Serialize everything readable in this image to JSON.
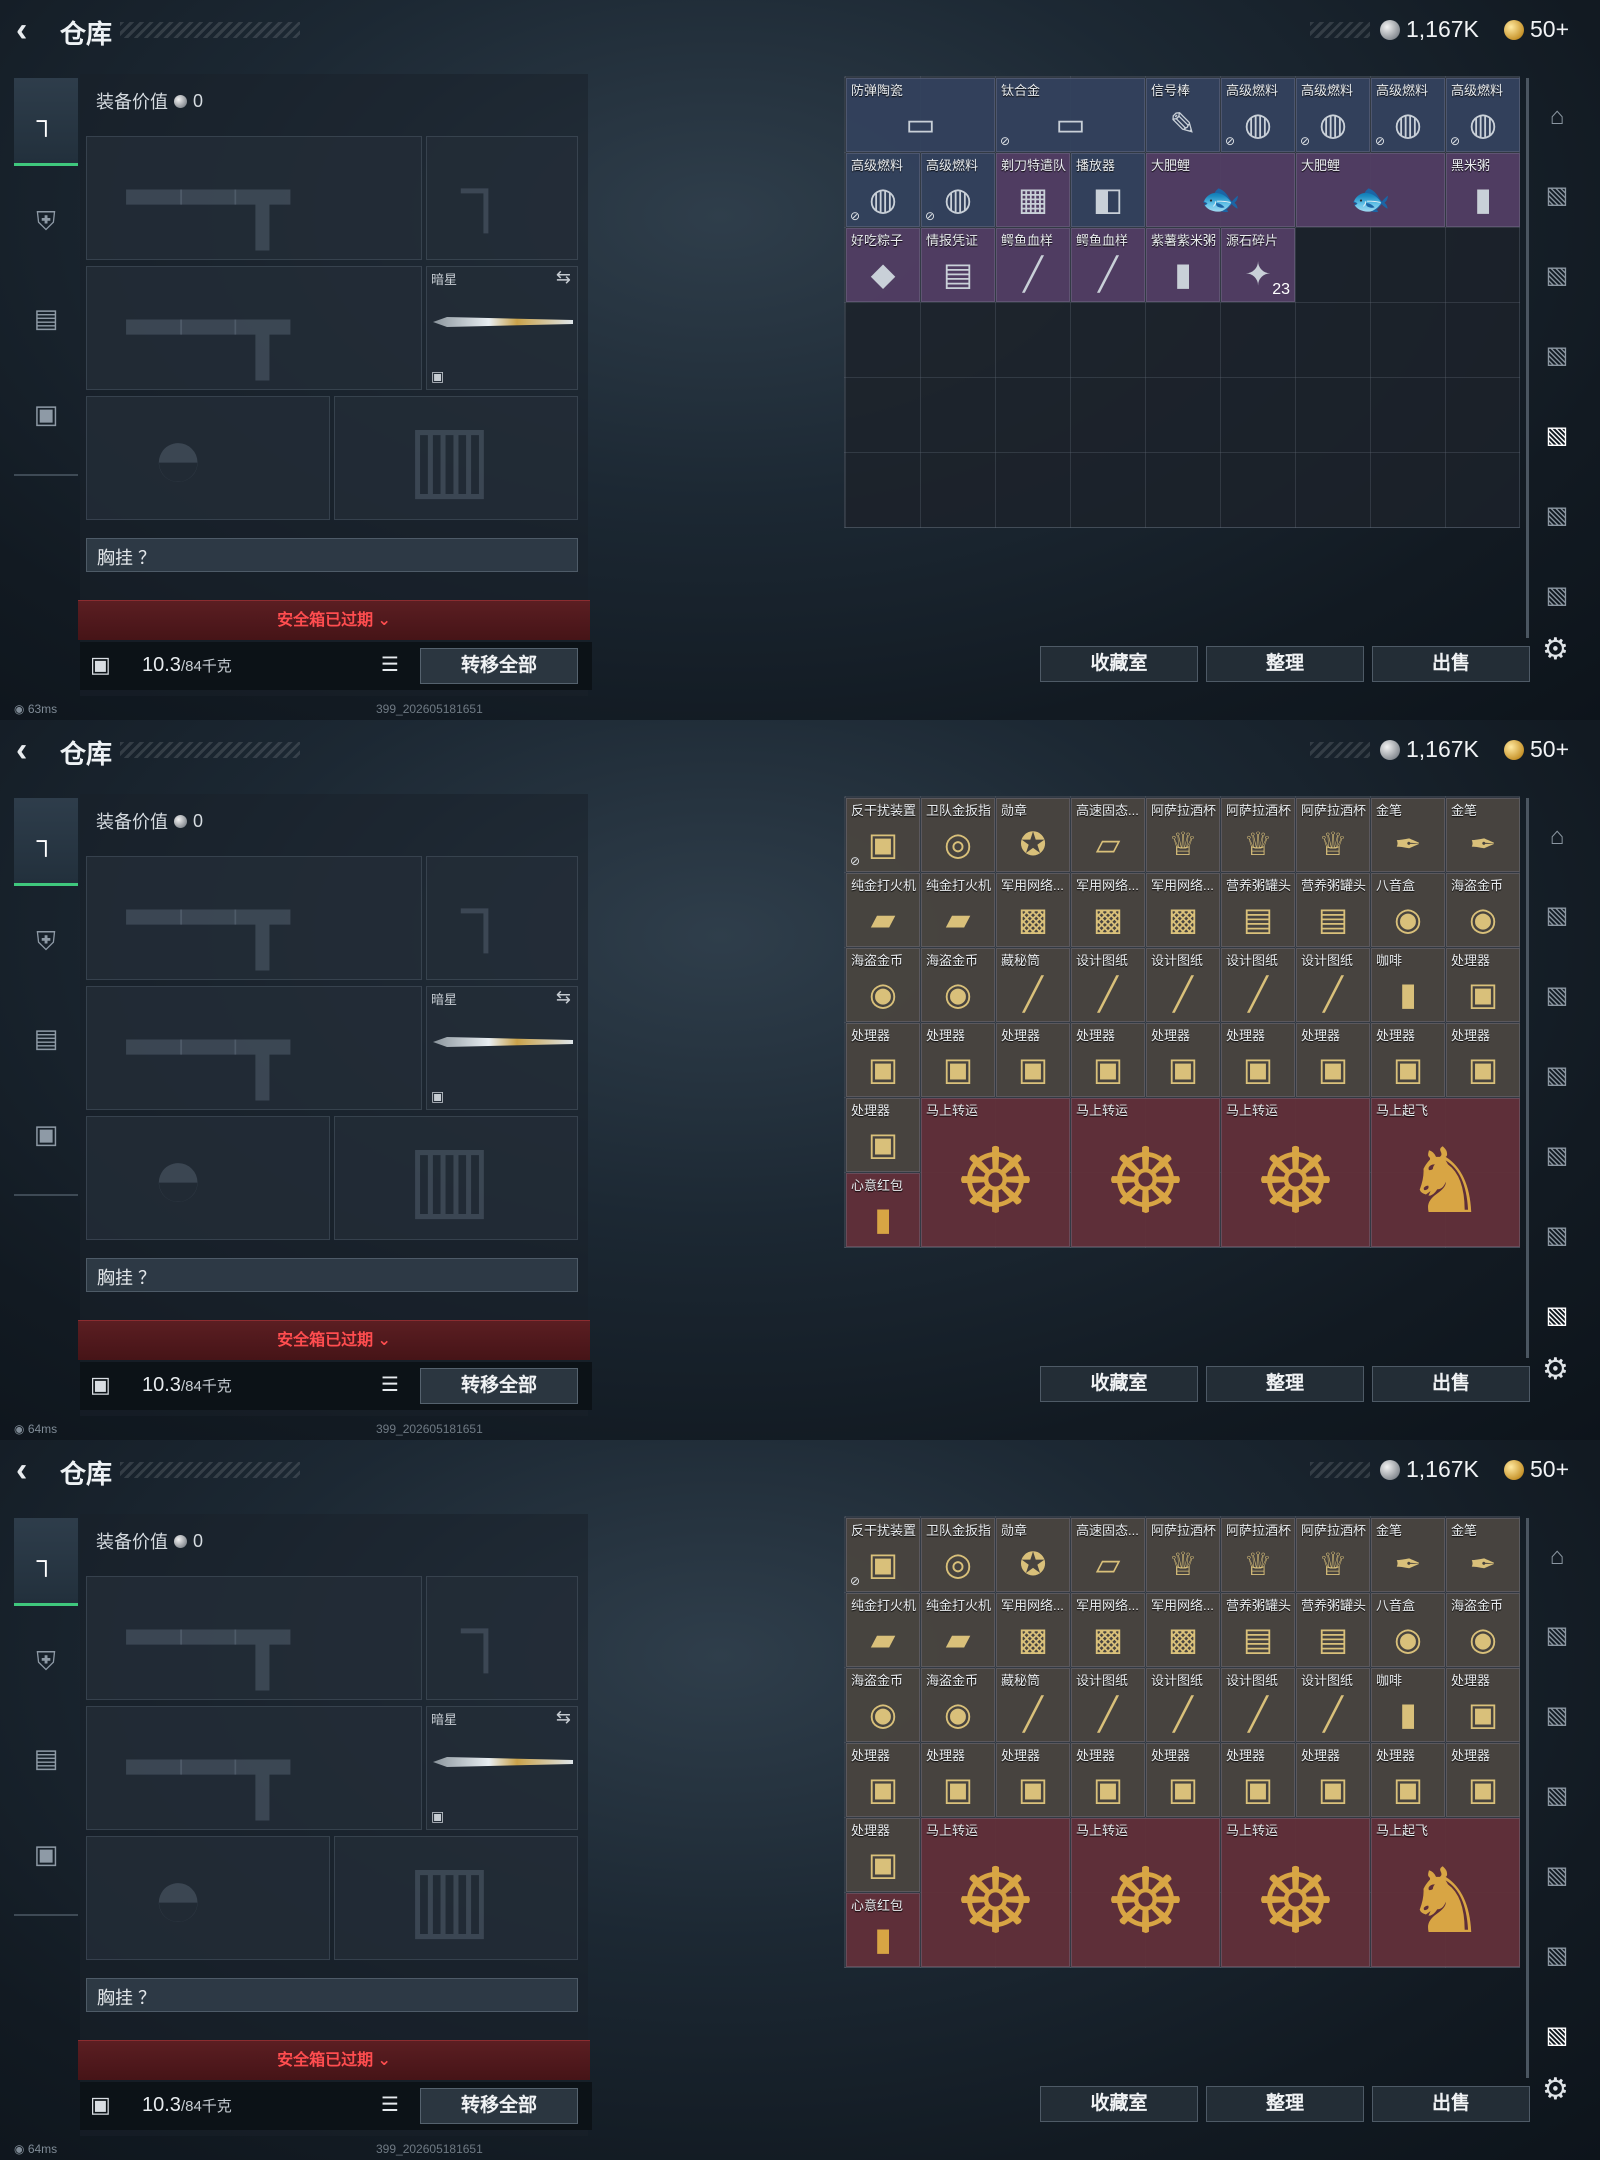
{
  "panels": [
    {
      "header": {
        "title": "仓库",
        "silver": "1,167K",
        "gold": "50+"
      },
      "equip_value_label": "装备价值",
      "equip_value": "0",
      "melee_label": "暗星",
      "chest_label": "胸挂",
      "safebox": "安全箱已过期",
      "weight": "10.3",
      "weight_max": "/84千克",
      "transfer": "转移全部",
      "actions": [
        "收藏室",
        "整理",
        "出售"
      ],
      "status": "63ms",
      "build": "399_202605181651",
      "items": [
        {
          "name": "防弹陶瓷",
          "icon": "▭",
          "r": 0,
          "c": 0,
          "w": 2,
          "h": 1,
          "tone": "blue"
        },
        {
          "name": "钛合金",
          "icon": "▭",
          "r": 0,
          "c": 2,
          "w": 2,
          "h": 1,
          "tone": "blue",
          "mark": "⊘"
        },
        {
          "name": "信号棒",
          "icon": "✎",
          "r": 0,
          "c": 4,
          "w": 1,
          "h": 1,
          "tone": "blue"
        },
        {
          "name": "高级燃料",
          "icon": "◍",
          "r": 0,
          "c": 5,
          "w": 1,
          "h": 1,
          "tone": "blue",
          "mark": "⊘"
        },
        {
          "name": "高级燃料",
          "icon": "◍",
          "r": 0,
          "c": 6,
          "w": 1,
          "h": 1,
          "tone": "blue",
          "mark": "⊘"
        },
        {
          "name": "高级燃料",
          "icon": "◍",
          "r": 0,
          "c": 7,
          "w": 1,
          "h": 1,
          "tone": "blue",
          "mark": "⊘"
        },
        {
          "name": "高级燃料",
          "icon": "◍",
          "r": 0,
          "c": 8,
          "w": 1,
          "h": 1,
          "tone": "blue",
          "mark": "⊘"
        },
        {
          "name": "高级燃料",
          "icon": "◍",
          "r": 1,
          "c": 0,
          "w": 1,
          "h": 1,
          "tone": "blue",
          "mark": "⊘"
        },
        {
          "name": "高级燃料",
          "icon": "◍",
          "r": 1,
          "c": 1,
          "w": 1,
          "h": 1,
          "tone": "blue",
          "mark": "⊘"
        },
        {
          "name": "剃刀特遣队",
          "icon": "▦",
          "r": 1,
          "c": 2,
          "w": 1,
          "h": 1,
          "tone": "purple"
        },
        {
          "name": "播放器",
          "icon": "◧",
          "r": 1,
          "c": 3,
          "w": 1,
          "h": 1,
          "tone": "blue"
        },
        {
          "name": "大肥鲤",
          "icon": "🐟",
          "r": 1,
          "c": 4,
          "w": 2,
          "h": 1,
          "tone": "purple"
        },
        {
          "name": "大肥鲤",
          "icon": "🐟",
          "r": 1,
          "c": 6,
          "w": 2,
          "h": 1,
          "tone": "purple"
        },
        {
          "name": "黑米粥",
          "icon": "▮",
          "r": 1,
          "c": 8,
          "w": 1,
          "h": 1,
          "tone": "purple"
        },
        {
          "name": "好吃粽子",
          "icon": "◆",
          "r": 2,
          "c": 0,
          "w": 1,
          "h": 1,
          "tone": "purple"
        },
        {
          "name": "情报凭证",
          "icon": "▤",
          "r": 2,
          "c": 1,
          "w": 1,
          "h": 1,
          "tone": "purple"
        },
        {
          "name": "鳄鱼血样",
          "icon": "╱",
          "r": 2,
          "c": 2,
          "w": 1,
          "h": 1,
          "tone": "purple"
        },
        {
          "name": "鳄鱼血样",
          "icon": "╱",
          "r": 2,
          "c": 3,
          "w": 1,
          "h": 1,
          "tone": "purple"
        },
        {
          "name": "紫薯紫米粥",
          "icon": "▮",
          "r": 2,
          "c": 4,
          "w": 1,
          "h": 1,
          "tone": "purple"
        },
        {
          "name": "源石碎片",
          "icon": "✦",
          "r": 2,
          "c": 5,
          "w": 1,
          "h": 1,
          "tone": "purple",
          "count": "23"
        }
      ]
    },
    {
      "header": {
        "title": "仓库",
        "silver": "1,167K",
        "gold": "50+"
      },
      "equip_value_label": "装备价值",
      "equip_value": "0",
      "melee_label": "暗星",
      "chest_label": "胸挂",
      "safebox": "安全箱已过期",
      "weight": "10.3",
      "weight_max": "/84千克",
      "transfer": "转移全部",
      "actions": [
        "收藏室",
        "整理",
        "出售"
      ],
      "status": "64ms",
      "build": "399_202605181651",
      "items": [
        {
          "name": "反干扰装置",
          "icon": "▣",
          "r": 0,
          "c": 0,
          "w": 1,
          "h": 1,
          "tone": "gold",
          "mark": "⊘"
        },
        {
          "name": "卫队金扳指",
          "icon": "◎",
          "r": 0,
          "c": 1,
          "w": 1,
          "h": 1,
          "tone": "gold"
        },
        {
          "name": "勋章",
          "icon": "✪",
          "r": 0,
          "c": 2,
          "w": 1,
          "h": 1,
          "tone": "gold"
        },
        {
          "name": "高速固态...",
          "icon": "▱",
          "r": 0,
          "c": 3,
          "w": 1,
          "h": 1,
          "tone": "gold"
        },
        {
          "name": "阿萨拉酒杯",
          "icon": "♕",
          "r": 0,
          "c": 4,
          "w": 1,
          "h": 1,
          "tone": "gold"
        },
        {
          "name": "阿萨拉酒杯",
          "icon": "♕",
          "r": 0,
          "c": 5,
          "w": 1,
          "h": 1,
          "tone": "gold"
        },
        {
          "name": "阿萨拉酒杯",
          "icon": "♕",
          "r": 0,
          "c": 6,
          "w": 1,
          "h": 1,
          "tone": "gold"
        },
        {
          "name": "金笔",
          "icon": "✒",
          "r": 0,
          "c": 7,
          "w": 1,
          "h": 1,
          "tone": "gold"
        },
        {
          "name": "金笔",
          "icon": "✒",
          "r": 0,
          "c": 8,
          "w": 1,
          "h": 1,
          "tone": "gold"
        },
        {
          "name": "纯金打火机",
          "icon": "▰",
          "r": 1,
          "c": 0,
          "w": 1,
          "h": 1,
          "tone": "gold"
        },
        {
          "name": "纯金打火机",
          "icon": "▰",
          "r": 1,
          "c": 1,
          "w": 1,
          "h": 1,
          "tone": "gold"
        },
        {
          "name": "军用网络...",
          "icon": "▩",
          "r": 1,
          "c": 2,
          "w": 1,
          "h": 1,
          "tone": "gold"
        },
        {
          "name": "军用网络...",
          "icon": "▩",
          "r": 1,
          "c": 3,
          "w": 1,
          "h": 1,
          "tone": "gold"
        },
        {
          "name": "军用网络...",
          "icon": "▩",
          "r": 1,
          "c": 4,
          "w": 1,
          "h": 1,
          "tone": "gold"
        },
        {
          "name": "营养粥罐头",
          "icon": "▤",
          "r": 1,
          "c": 5,
          "w": 1,
          "h": 1,
          "tone": "gold"
        },
        {
          "name": "营养粥罐头",
          "icon": "▤",
          "r": 1,
          "c": 6,
          "w": 1,
          "h": 1,
          "tone": "gold"
        },
        {
          "name": "八音盒",
          "icon": "◉",
          "r": 1,
          "c": 7,
          "w": 1,
          "h": 1,
          "tone": "gold"
        },
        {
          "name": "海盗金币",
          "icon": "◉",
          "r": 1,
          "c": 8,
          "w": 1,
          "h": 1,
          "tone": "gold"
        },
        {
          "name": "海盗金币",
          "icon": "◉",
          "r": 2,
          "c": 0,
          "w": 1,
          "h": 1,
          "tone": "gold"
        },
        {
          "name": "海盗金币",
          "icon": "◉",
          "r": 2,
          "c": 1,
          "w": 1,
          "h": 1,
          "tone": "gold"
        },
        {
          "name": "藏秘筒",
          "icon": "╱",
          "r": 2,
          "c": 2,
          "w": 1,
          "h": 1,
          "tone": "gold"
        },
        {
          "name": "设计图纸",
          "icon": "╱",
          "r": 2,
          "c": 3,
          "w": 1,
          "h": 1,
          "tone": "gold"
        },
        {
          "name": "设计图纸",
          "icon": "╱",
          "r": 2,
          "c": 4,
          "w": 1,
          "h": 1,
          "tone": "gold"
        },
        {
          "name": "设计图纸",
          "icon": "╱",
          "r": 2,
          "c": 5,
          "w": 1,
          "h": 1,
          "tone": "gold"
        },
        {
          "name": "设计图纸",
          "icon": "╱",
          "r": 2,
          "c": 6,
          "w": 1,
          "h": 1,
          "tone": "gold"
        },
        {
          "name": "咖啡",
          "icon": "▮",
          "r": 2,
          "c": 7,
          "w": 1,
          "h": 1,
          "tone": "gold"
        },
        {
          "name": "处理器",
          "icon": "▣",
          "r": 2,
          "c": 8,
          "w": 1,
          "h": 1,
          "tone": "gold"
        },
        {
          "name": "处理器",
          "icon": "▣",
          "r": 3,
          "c": 0,
          "w": 1,
          "h": 1,
          "tone": "gold"
        },
        {
          "name": "处理器",
          "icon": "▣",
          "r": 3,
          "c": 1,
          "w": 1,
          "h": 1,
          "tone": "gold"
        },
        {
          "name": "处理器",
          "icon": "▣",
          "r": 3,
          "c": 2,
          "w": 1,
          "h": 1,
          "tone": "gold"
        },
        {
          "name": "处理器",
          "icon": "▣",
          "r": 3,
          "c": 3,
          "w": 1,
          "h": 1,
          "tone": "gold"
        },
        {
          "name": "处理器",
          "icon": "▣",
          "r": 3,
          "c": 4,
          "w": 1,
          "h": 1,
          "tone": "gold"
        },
        {
          "name": "处理器",
          "icon": "▣",
          "r": 3,
          "c": 5,
          "w": 1,
          "h": 1,
          "tone": "gold"
        },
        {
          "name": "处理器",
          "icon": "▣",
          "r": 3,
          "c": 6,
          "w": 1,
          "h": 1,
          "tone": "gold"
        },
        {
          "name": "处理器",
          "icon": "▣",
          "r": 3,
          "c": 7,
          "w": 1,
          "h": 1,
          "tone": "gold"
        },
        {
          "name": "处理器",
          "icon": "▣",
          "r": 3,
          "c": 8,
          "w": 1,
          "h": 1,
          "tone": "gold"
        },
        {
          "name": "处理器",
          "icon": "▣",
          "r": 4,
          "c": 0,
          "w": 1,
          "h": 1,
          "tone": "gold"
        },
        {
          "name": "马上转运",
          "icon": "☸",
          "r": 4,
          "c": 1,
          "w": 2,
          "h": 2,
          "tone": "red"
        },
        {
          "name": "马上转运",
          "icon": "☸",
          "r": 4,
          "c": 3,
          "w": 2,
          "h": 2,
          "tone": "red"
        },
        {
          "name": "马上转运",
          "icon": "☸",
          "r": 4,
          "c": 5,
          "w": 2,
          "h": 2,
          "tone": "red"
        },
        {
          "name": "马上起飞",
          "icon": "♞",
          "r": 4,
          "c": 7,
          "w": 2,
          "h": 2,
          "tone": "red"
        },
        {
          "name": "心意红包",
          "icon": "▮",
          "r": 5,
          "c": 0,
          "w": 1,
          "h": 1,
          "tone": "red"
        }
      ]
    },
    {
      "header": {
        "title": "仓库",
        "silver": "1,167K",
        "gold": "50+"
      },
      "equip_value_label": "装备价值",
      "equip_value": "0",
      "melee_label": "暗星",
      "chest_label": "胸挂",
      "safebox": "安全箱已过期",
      "weight": "10.3",
      "weight_max": "/84千克",
      "transfer": "转移全部",
      "actions": [
        "收藏室",
        "整理",
        "出售"
      ],
      "status": "64ms",
      "build": "399_202605181651",
      "items": [
        {
          "name": "反干扰装置",
          "icon": "▣",
          "r": 0,
          "c": 0,
          "w": 1,
          "h": 1,
          "tone": "gold",
          "mark": "⊘"
        },
        {
          "name": "卫队金扳指",
          "icon": "◎",
          "r": 0,
          "c": 1,
          "w": 1,
          "h": 1,
          "tone": "gold"
        },
        {
          "name": "勋章",
          "icon": "✪",
          "r": 0,
          "c": 2,
          "w": 1,
          "h": 1,
          "tone": "gold"
        },
        {
          "name": "高速固态...",
          "icon": "▱",
          "r": 0,
          "c": 3,
          "w": 1,
          "h": 1,
          "tone": "gold"
        },
        {
          "name": "阿萨拉酒杯",
          "icon": "♕",
          "r": 0,
          "c": 4,
          "w": 1,
          "h": 1,
          "tone": "gold"
        },
        {
          "name": "阿萨拉酒杯",
          "icon": "♕",
          "r": 0,
          "c": 5,
          "w": 1,
          "h": 1,
          "tone": "gold"
        },
        {
          "name": "阿萨拉酒杯",
          "icon": "♕",
          "r": 0,
          "c": 6,
          "w": 1,
          "h": 1,
          "tone": "gold"
        },
        {
          "name": "金笔",
          "icon": "✒",
          "r": 0,
          "c": 7,
          "w": 1,
          "h": 1,
          "tone": "gold"
        },
        {
          "name": "金笔",
          "icon": "✒",
          "r": 0,
          "c": 8,
          "w": 1,
          "h": 1,
          "tone": "gold"
        },
        {
          "name": "纯金打火机",
          "icon": "▰",
          "r": 1,
          "c": 0,
          "w": 1,
          "h": 1,
          "tone": "gold"
        },
        {
          "name": "纯金打火机",
          "icon": "▰",
          "r": 1,
          "c": 1,
          "w": 1,
          "h": 1,
          "tone": "gold"
        },
        {
          "name": "军用网络...",
          "icon": "▩",
          "r": 1,
          "c": 2,
          "w": 1,
          "h": 1,
          "tone": "gold"
        },
        {
          "name": "军用网络...",
          "icon": "▩",
          "r": 1,
          "c": 3,
          "w": 1,
          "h": 1,
          "tone": "gold"
        },
        {
          "name": "军用网络...",
          "icon": "▩",
          "r": 1,
          "c": 4,
          "w": 1,
          "h": 1,
          "tone": "gold"
        },
        {
          "name": "营养粥罐头",
          "icon": "▤",
          "r": 1,
          "c": 5,
          "w": 1,
          "h": 1,
          "tone": "gold"
        },
        {
          "name": "营养粥罐头",
          "icon": "▤",
          "r": 1,
          "c": 6,
          "w": 1,
          "h": 1,
          "tone": "gold"
        },
        {
          "name": "八音盒",
          "icon": "◉",
          "r": 1,
          "c": 7,
          "w": 1,
          "h": 1,
          "tone": "gold"
        },
        {
          "name": "海盗金币",
          "icon": "◉",
          "r": 1,
          "c": 8,
          "w": 1,
          "h": 1,
          "tone": "gold"
        },
        {
          "name": "海盗金币",
          "icon": "◉",
          "r": 2,
          "c": 0,
          "w": 1,
          "h": 1,
          "tone": "gold"
        },
        {
          "name": "海盗金币",
          "icon": "◉",
          "r": 2,
          "c": 1,
          "w": 1,
          "h": 1,
          "tone": "gold"
        },
        {
          "name": "藏秘筒",
          "icon": "╱",
          "r": 2,
          "c": 2,
          "w": 1,
          "h": 1,
          "tone": "gold"
        },
        {
          "name": "设计图纸",
          "icon": "╱",
          "r": 2,
          "c": 3,
          "w": 1,
          "h": 1,
          "tone": "gold"
        },
        {
          "name": "设计图纸",
          "icon": "╱",
          "r": 2,
          "c": 4,
          "w": 1,
          "h": 1,
          "tone": "gold"
        },
        {
          "name": "设计图纸",
          "icon": "╱",
          "r": 2,
          "c": 5,
          "w": 1,
          "h": 1,
          "tone": "gold"
        },
        {
          "name": "设计图纸",
          "icon": "╱",
          "r": 2,
          "c": 6,
          "w": 1,
          "h": 1,
          "tone": "gold"
        },
        {
          "name": "咖啡",
          "icon": "▮",
          "r": 2,
          "c": 7,
          "w": 1,
          "h": 1,
          "tone": "gold"
        },
        {
          "name": "处理器",
          "icon": "▣",
          "r": 2,
          "c": 8,
          "w": 1,
          "h": 1,
          "tone": "gold"
        },
        {
          "name": "处理器",
          "icon": "▣",
          "r": 3,
          "c": 0,
          "w": 1,
          "h": 1,
          "tone": "gold"
        },
        {
          "name": "处理器",
          "icon": "▣",
          "r": 3,
          "c": 1,
          "w": 1,
          "h": 1,
          "tone": "gold"
        },
        {
          "name": "处理器",
          "icon": "▣",
          "r": 3,
          "c": 2,
          "w": 1,
          "h": 1,
          "tone": "gold"
        },
        {
          "name": "处理器",
          "icon": "▣",
          "r": 3,
          "c": 3,
          "w": 1,
          "h": 1,
          "tone": "gold"
        },
        {
          "name": "处理器",
          "icon": "▣",
          "r": 3,
          "c": 4,
          "w": 1,
          "h": 1,
          "tone": "gold"
        },
        {
          "name": "处理器",
          "icon": "▣",
          "r": 3,
          "c": 5,
          "w": 1,
          "h": 1,
          "tone": "gold"
        },
        {
          "name": "处理器",
          "icon": "▣",
          "r": 3,
          "c": 6,
          "w": 1,
          "h": 1,
          "tone": "gold"
        },
        {
          "name": "处理器",
          "icon": "▣",
          "r": 3,
          "c": 7,
          "w": 1,
          "h": 1,
          "tone": "gold"
        },
        {
          "name": "处理器",
          "icon": "▣",
          "r": 3,
          "c": 8,
          "w": 1,
          "h": 1,
          "tone": "gold"
        },
        {
          "name": "处理器",
          "icon": "▣",
          "r": 4,
          "c": 0,
          "w": 1,
          "h": 1,
          "tone": "gold"
        },
        {
          "name": "马上转运",
          "icon": "☸",
          "r": 4,
          "c": 1,
          "w": 2,
          "h": 2,
          "tone": "red"
        },
        {
          "name": "马上转运",
          "icon": "☸",
          "r": 4,
          "c": 3,
          "w": 2,
          "h": 2,
          "tone": "red"
        },
        {
          "name": "马上转运",
          "icon": "☸",
          "r": 4,
          "c": 5,
          "w": 2,
          "h": 2,
          "tone": "red"
        },
        {
          "name": "马上起飞",
          "icon": "♞",
          "r": 4,
          "c": 7,
          "w": 2,
          "h": 2,
          "tone": "red"
        },
        {
          "name": "心意红包",
          "icon": "▮",
          "r": 5,
          "c": 0,
          "w": 1,
          "h": 1,
          "tone": "red"
        }
      ]
    }
  ],
  "icons": {
    "back": "chevron-left-icon",
    "silver": "silver-coin-icon",
    "gold": "gold-coin-icon",
    "settings": "gear-icon"
  },
  "colors": {
    "accent_green": "#3fc87d",
    "warning_red": "#ff4d4f"
  }
}
